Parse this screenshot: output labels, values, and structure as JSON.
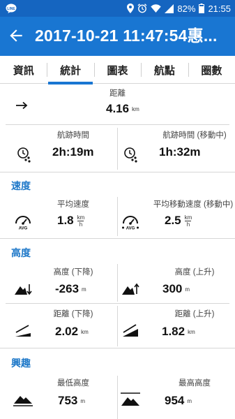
{
  "status_bar": {
    "battery": "82%",
    "time": "21:55"
  },
  "app_bar": {
    "title": "2017-10-21 11:47:54惠..."
  },
  "tabs": [
    {
      "label": "資訊",
      "active": false
    },
    {
      "label": "統計",
      "active": true
    },
    {
      "label": "圖表",
      "active": false
    },
    {
      "label": "航點",
      "active": false
    },
    {
      "label": "圈數",
      "active": false
    }
  ],
  "stats": {
    "distance": {
      "label": "距離",
      "value": "4.16",
      "unit": "km"
    },
    "duration": {
      "label": "航跡時間",
      "value": "2h:19m"
    },
    "moving_duration": {
      "label": "航跡時間 (移動中)",
      "value": "1h:32m"
    }
  },
  "speed": {
    "section_title": "速度",
    "avg_speed": {
      "label": "平均速度",
      "value": "1.8",
      "unit_top": "km",
      "unit_bottom": "h"
    },
    "avg_moving_speed": {
      "label": "平均移動速度 (移動中)",
      "value": "2.5",
      "unit_top": "km",
      "unit_bottom": "h"
    }
  },
  "altitude": {
    "section_title": "高度",
    "descent": {
      "label": "高度 (下降)",
      "value": "-263",
      "unit": "m"
    },
    "ascent": {
      "label": "高度 (上升)",
      "value": "300",
      "unit": "m"
    },
    "descent_distance": {
      "label": "距離 (下降)",
      "value": "2.02",
      "unit": "km"
    },
    "ascent_distance": {
      "label": "距離 (上升)",
      "value": "1.82",
      "unit": "km"
    }
  },
  "interest": {
    "section_title": "興趣",
    "min_altitude": {
      "label": "最低高度",
      "value": "753",
      "unit": "m"
    },
    "max_altitude": {
      "label": "最高高度",
      "value": "954",
      "unit": "m"
    }
  }
}
